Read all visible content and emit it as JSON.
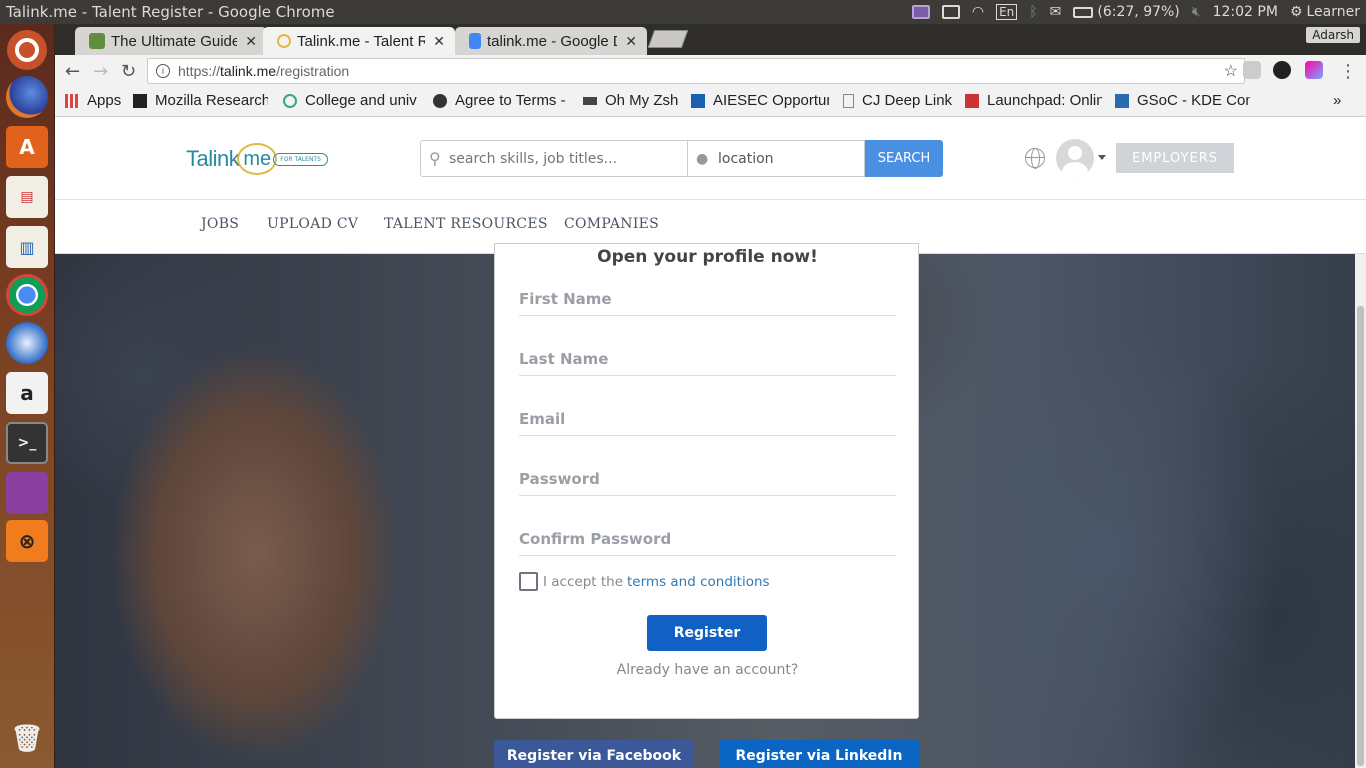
{
  "system_bar": {
    "window_title": "Talink.me - Talent Register - Google Chrome",
    "keyboard": "En",
    "battery": "(6:27, 97%)",
    "clock": "12:02 PM",
    "user": "Learner"
  },
  "launcher": {
    "apps": [
      "ubuntu-dash-icon",
      "firefox-icon",
      "software-center-icon",
      "impress-icon",
      "writer-icon",
      "chrome-icon",
      "thunderbird-icon",
      "amazon-icon",
      "terminal-icon",
      "app-icon",
      "xampp-icon",
      "trash-icon"
    ]
  },
  "browser": {
    "tabs": [
      {
        "label": "The Ultimate Guide t",
        "close": "✕"
      },
      {
        "label": "Talink.me - Talent R",
        "close": "✕"
      },
      {
        "label": "talink.me - Google D",
        "close": "✕"
      }
    ],
    "profile": "Adarsh",
    "url": {
      "scheme": "https://",
      "host": "talink.me",
      "path": "/registration"
    },
    "bookmarks": [
      {
        "label": "Apps",
        "color": "#d44"
      },
      {
        "label": "Mozilla Research",
        "color": "#222"
      },
      {
        "label": "College and univ",
        "color": "#3a7"
      },
      {
        "label": "Agree to Terms -",
        "color": "#333"
      },
      {
        "label": "Oh My Zsh",
        "color": "#444"
      },
      {
        "label": "AIESEC Opportun",
        "color": "#1a5fb4"
      },
      {
        "label": "CJ Deep Link",
        "color": "#888"
      },
      {
        "label": "Launchpad: Onlin",
        "color": "#c33"
      },
      {
        "label": "GSoC - KDE Com",
        "color": "#2a6bb0"
      }
    ],
    "more": "»"
  },
  "site": {
    "logo": {
      "text": "Talink",
      "me": "me",
      "tagline": "FOR TALENTS"
    },
    "search": {
      "placeholder": "search skills, job titles...",
      "location_value": "location",
      "button": "SEARCH"
    },
    "employers": "EMPLOYERS",
    "nav": [
      "JOBS",
      "UPLOAD CV",
      "TALENT RESOURCES",
      "COMPANIES"
    ]
  },
  "form": {
    "title": "Open your profile now!",
    "fields": [
      "First Name",
      "Last Name",
      "Email",
      "Password",
      "Confirm Password"
    ],
    "accept_text": "I accept the",
    "terms_link": "terms and conditions",
    "register": "Register",
    "already": "Already have an account?",
    "facebook": "Register via Facebook",
    "linkedin": "Register via LinkedIn"
  },
  "colors": {
    "accent": "#4a90e2",
    "register": "#1160c4",
    "facebook": "#3b5998",
    "linkedin": "#0a66c2"
  }
}
